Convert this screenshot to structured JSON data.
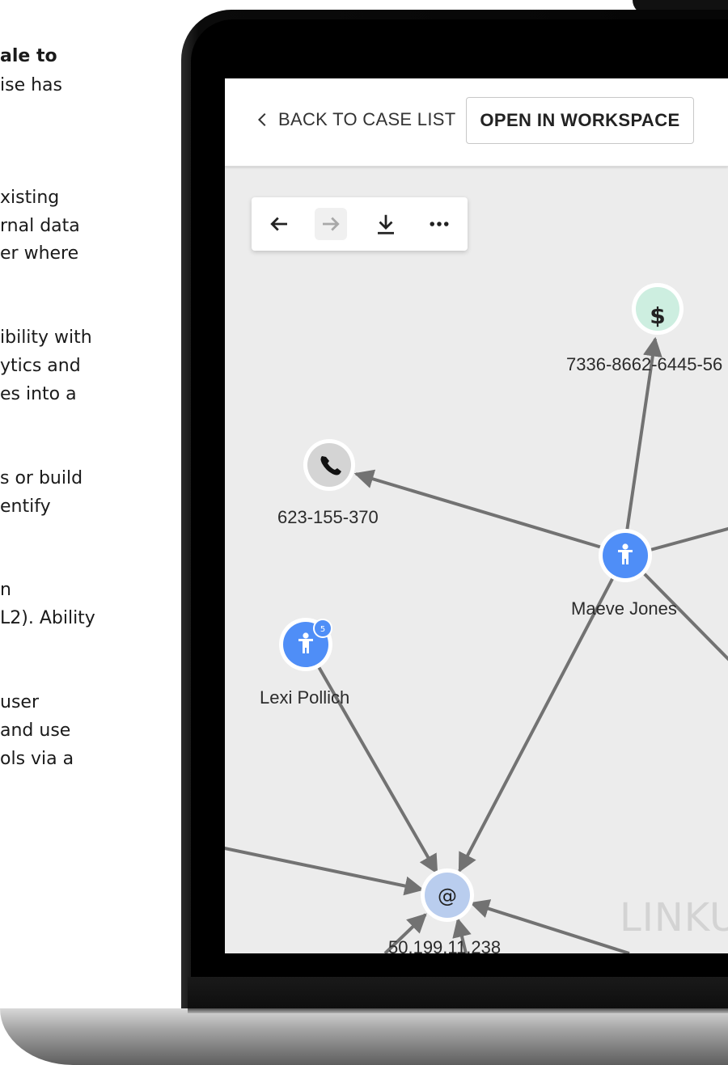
{
  "left_text": {
    "lines": [
      "ale to",
      "ise has",
      "xisting",
      "rnal data",
      "er where",
      "ibility with",
      "ytics and",
      "es into a",
      "s or build",
      "entify",
      "n",
      "L2). Ability",
      "user",
      "and use",
      "ols via a"
    ]
  },
  "header": {
    "back_label": "BACK TO CASE LIST",
    "open_label": "OPEN IN WORKSPACE"
  },
  "toolbar": {
    "icons": [
      "back-arrow-icon",
      "forward-arrow-icon",
      "download-icon",
      "more-icon"
    ]
  },
  "graph": {
    "nodes": {
      "card": {
        "label": "7336-8662-6445-56",
        "icon": "dollar-icon",
        "color": "#cdeee0"
      },
      "phone": {
        "label": "623-155-370",
        "icon": "phone-icon",
        "color": "#d4d4d4"
      },
      "maeve": {
        "label": "Maeve Jones",
        "icon": "person-icon",
        "color": "#4f8ef7"
      },
      "lexi": {
        "label": "Lexi Pollich",
        "icon": "person-icon",
        "color": "#4f8ef7",
        "badge": "5"
      },
      "ip": {
        "label": "50.199.11.238",
        "icon": "at-icon",
        "color": "#b9cdee",
        "glyph": "@"
      }
    }
  },
  "watermark": "LINKU",
  "colors": {
    "edge": "#727272",
    "accent": "#4f8ef7"
  }
}
